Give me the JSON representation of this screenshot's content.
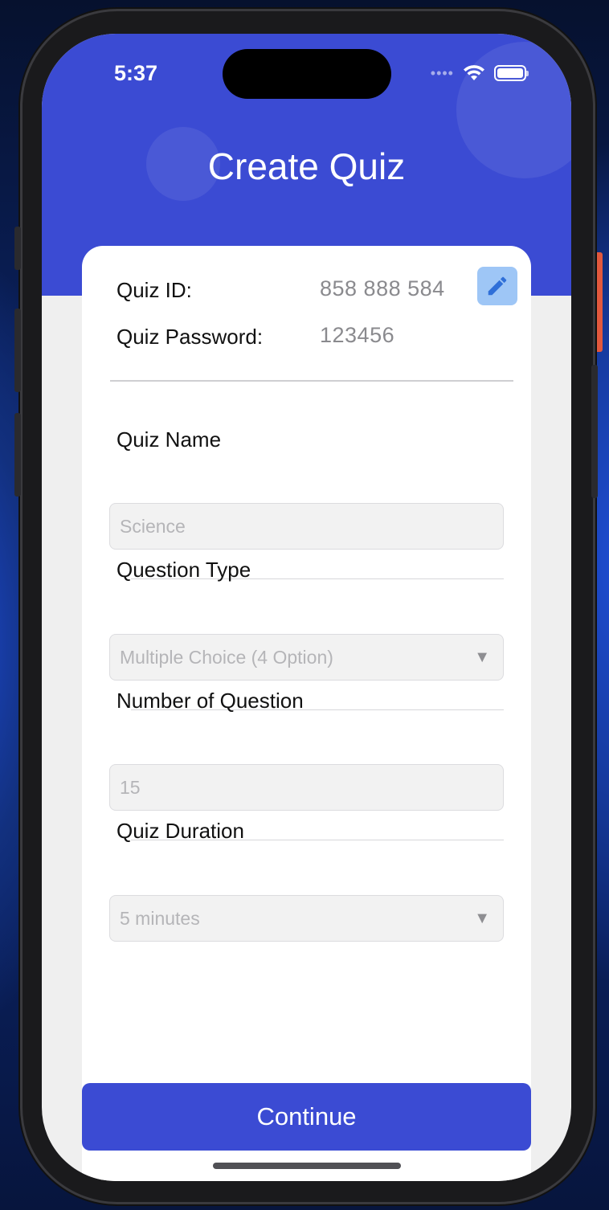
{
  "status_bar": {
    "time": "5:37",
    "signal_dots": "••••"
  },
  "header": {
    "title": "Create Quiz"
  },
  "quiz_info": {
    "id_label": "Quiz ID:",
    "id_value": "858 888 584",
    "password_label": "Quiz Password:",
    "password_value": "123456"
  },
  "form": {
    "quiz_name": {
      "label": "Quiz Name",
      "placeholder": "Science"
    },
    "question_type": {
      "label": "Question Type",
      "value": "Multiple Choice (4 Option)"
    },
    "number_of_question": {
      "label": "Number of Question",
      "placeholder": "15"
    },
    "quiz_duration": {
      "label": "Quiz Duration",
      "value": "5 minutes"
    }
  },
  "actions": {
    "continue_label": "Continue"
  },
  "icons": {
    "edit": "pencil-icon",
    "dropdown": "caret-down-icon",
    "wifi": "wifi-icon",
    "battery": "battery-icon"
  },
  "colors": {
    "accent": "#3b4bd3",
    "edit_button": "#9ec6f6",
    "edit_icon": "#2f6fd8"
  }
}
